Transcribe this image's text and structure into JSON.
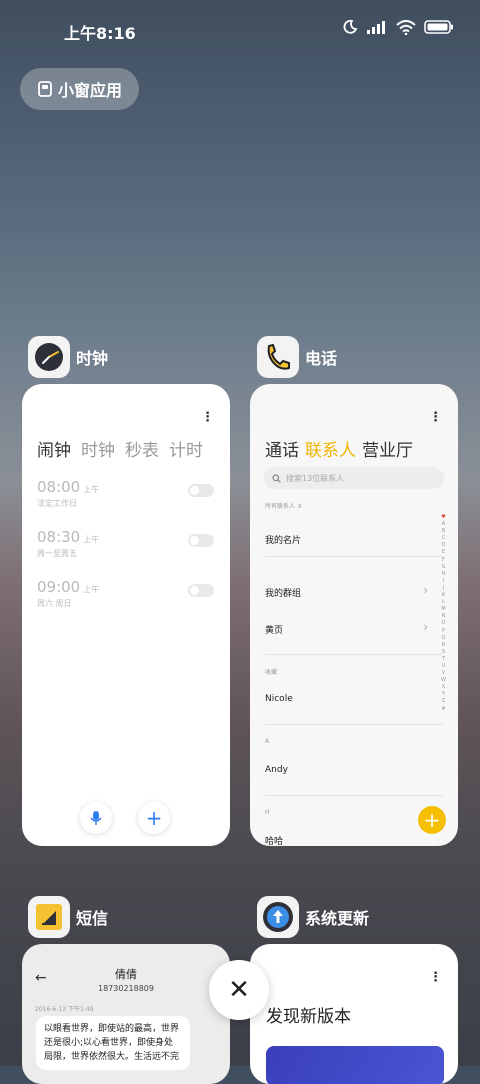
{
  "status_bar": {
    "time": "上午8:16"
  },
  "floating_window": {
    "label": "小窗应用"
  },
  "clock_app": {
    "name": "时钟",
    "tabs": [
      "闹钟",
      "时钟",
      "秒表",
      "计时"
    ],
    "alarms": [
      {
        "time": "08:00",
        "ampm": "上午",
        "repeat": "法定工作日"
      },
      {
        "time": "08:30",
        "ampm": "上午",
        "repeat": "周一至周五"
      },
      {
        "time": "09:00",
        "ampm": "上午",
        "repeat": "周六 周日"
      }
    ]
  },
  "phone_app": {
    "name": "电话",
    "tabs": [
      "通话",
      "联系人",
      "营业厅"
    ],
    "search_placeholder": "搜索13位联系人",
    "filter_label": "所有联系人",
    "rows": {
      "my_card": "我的名片",
      "my_groups": "我的群组",
      "yellow_pages": "黄页",
      "fav_header": "收藏",
      "nicole": "Nicole",
      "a_header": "A",
      "andy": "Andy",
      "h_header": "H",
      "haha": "哈哈"
    },
    "alpha_index": [
      "♥",
      "A",
      "B",
      "C",
      "D",
      "E",
      "F",
      "G",
      "H",
      "I",
      "J",
      "K",
      "L",
      "M",
      "N",
      "O",
      "P",
      "Q",
      "R",
      "S",
      "T",
      "U",
      "V",
      "W",
      "X",
      "Y",
      "Z",
      "#"
    ]
  },
  "sms_app": {
    "name": "短信",
    "contact": "倩倩",
    "number": "18730218809",
    "timestamp": "2016-6-13 下午1:49",
    "message": "以眼看世界，即使站的最高，世界还是很小;以心看世界，即使身处局限，世界依然很大。生活远不完"
  },
  "update_app": {
    "name": "系统更新",
    "title": "发现新版本"
  },
  "colors": {
    "accent_yellow": "#f1b400",
    "accent_blue": "#2f7ef1"
  }
}
